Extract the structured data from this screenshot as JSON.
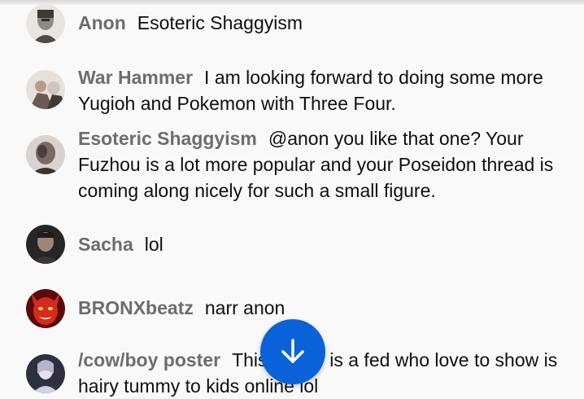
{
  "messages": [
    {
      "author": "Anon",
      "text": "Esoteric Shaggyism",
      "avatar": "monochrome-portrait-avatar"
    },
    {
      "author": "War Hammer",
      "text": "I am looking forward to doing some more Yugioh and Pokemon with Three Four.",
      "avatar": "figure-avatar"
    },
    {
      "author": "Esoteric Shaggyism",
      "text": "@anon you like that one? Your Fuzhou is a lot more popular and your Poseidon thread is coming along nicely for such a small figure.",
      "avatar": "dark-portrait-avatar"
    },
    {
      "author": "Sacha",
      "text": "lol",
      "avatar": "man-portrait-avatar"
    },
    {
      "author": "BRONXbeatz",
      "text": "narr anon",
      "avatar": "red-devil-avatar"
    },
    {
      "author": "/cow/boy poster",
      "text": "This poster is a fed who love to show is hairy tummy to kids online lol",
      "avatar": "pale-figure-avatar"
    }
  ],
  "scroll_button": {
    "icon": "arrow-down-icon"
  },
  "colors": {
    "author": "#6d6d6d",
    "text": "#0f0f0f",
    "accent": "#0a62d8",
    "background": "#f9f9f9"
  }
}
